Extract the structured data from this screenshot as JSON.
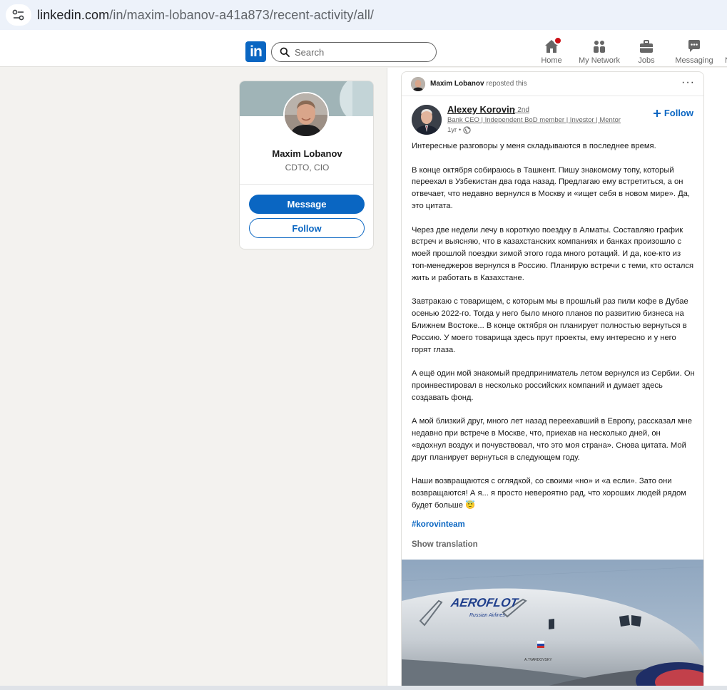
{
  "browser": {
    "url_host": "linkedin.com",
    "url_path": "/in/maxim-lobanov-a41a873/recent-activity/all/"
  },
  "nav": {
    "logo": "in",
    "search_placeholder": "Search",
    "items": [
      {
        "label": "Home",
        "icon": "home-icon",
        "badge": true
      },
      {
        "label": "My Network",
        "icon": "network-icon"
      },
      {
        "label": "Jobs",
        "icon": "jobs-icon"
      },
      {
        "label": "Messaging",
        "icon": "messaging-icon"
      },
      {
        "label": "N"
      }
    ]
  },
  "profile": {
    "name": "Maxim Lobanov",
    "headline": "CDTO, CIO",
    "message_label": "Message",
    "follow_label": "Follow"
  },
  "post": {
    "repost_name": "Maxim Lobanov",
    "repost_suffix": "reposted this",
    "more": "···",
    "author_name": "Alexey Korovin",
    "author_degree": "• 2nd",
    "author_headline": "Bank CEO | Independent BoD member | Investor | Mentor",
    "time": "1yr •",
    "follow_label": "Follow",
    "body": [
      "Интересные разговоры у меня складываются в последнее время.",
      "В конце октября собираюсь в Ташкент. Пишу знакомому топу, который переехал в Узбекистан два года назад. Предлагаю ему встретиться, а он отвечает, что недавно вернулся в Москву и «ищет себя в новом мире». Да, это цитата.",
      "Через две недели лечу в короткую поездку в Алматы. Составляю график встреч и выясняю, что в казахстанских компаниях и банках произошло с моей прошлой поездки зимой этого года много ротаций. И да, кое-кто из топ-менеджеров вернулся в Россию. Планирую встречи с теми, кто остался жить и работать в Казахстане.",
      "Завтракаю с товарищем, с которым мы в прошлый раз пили кофе в Дубае осенью 2022-го. Тогда у него было много планов по развитию бизнеса на Ближнем Востоке... В конце октября он планирует полностью вернуться в Россию. У моего товарища здесь прут проекты, ему интересно и у него горят глаза.",
      "А ещё один мой знакомый предприниматель летом вернулся из Сербии. Он проинвестировал в несколько российских компаний и думает здесь создавать фонд.",
      "А мой близкий друг, много лет назад переехавший в Европу, рассказал мне недавно при встрече в Москве, что, приехав на несколько дней, он «вдохнул воздух и почувствовал, что это моя страна». Снова цитата. Мой друг планирует вернуться в следующем году.",
      "Наши возвращаются с оглядкой, со своими «но» и «а если». Зато они возвращаются! А я... я просто невероятно рад, что хороших людей рядом будет больше 😇"
    ],
    "hashtag": "#korovinteam",
    "show_translation": "Show translation",
    "image_text": {
      "airline": "AEROFLOT",
      "subtitle": "Russian Airlines",
      "tail_name": "A.TVARDOVSKY"
    }
  }
}
